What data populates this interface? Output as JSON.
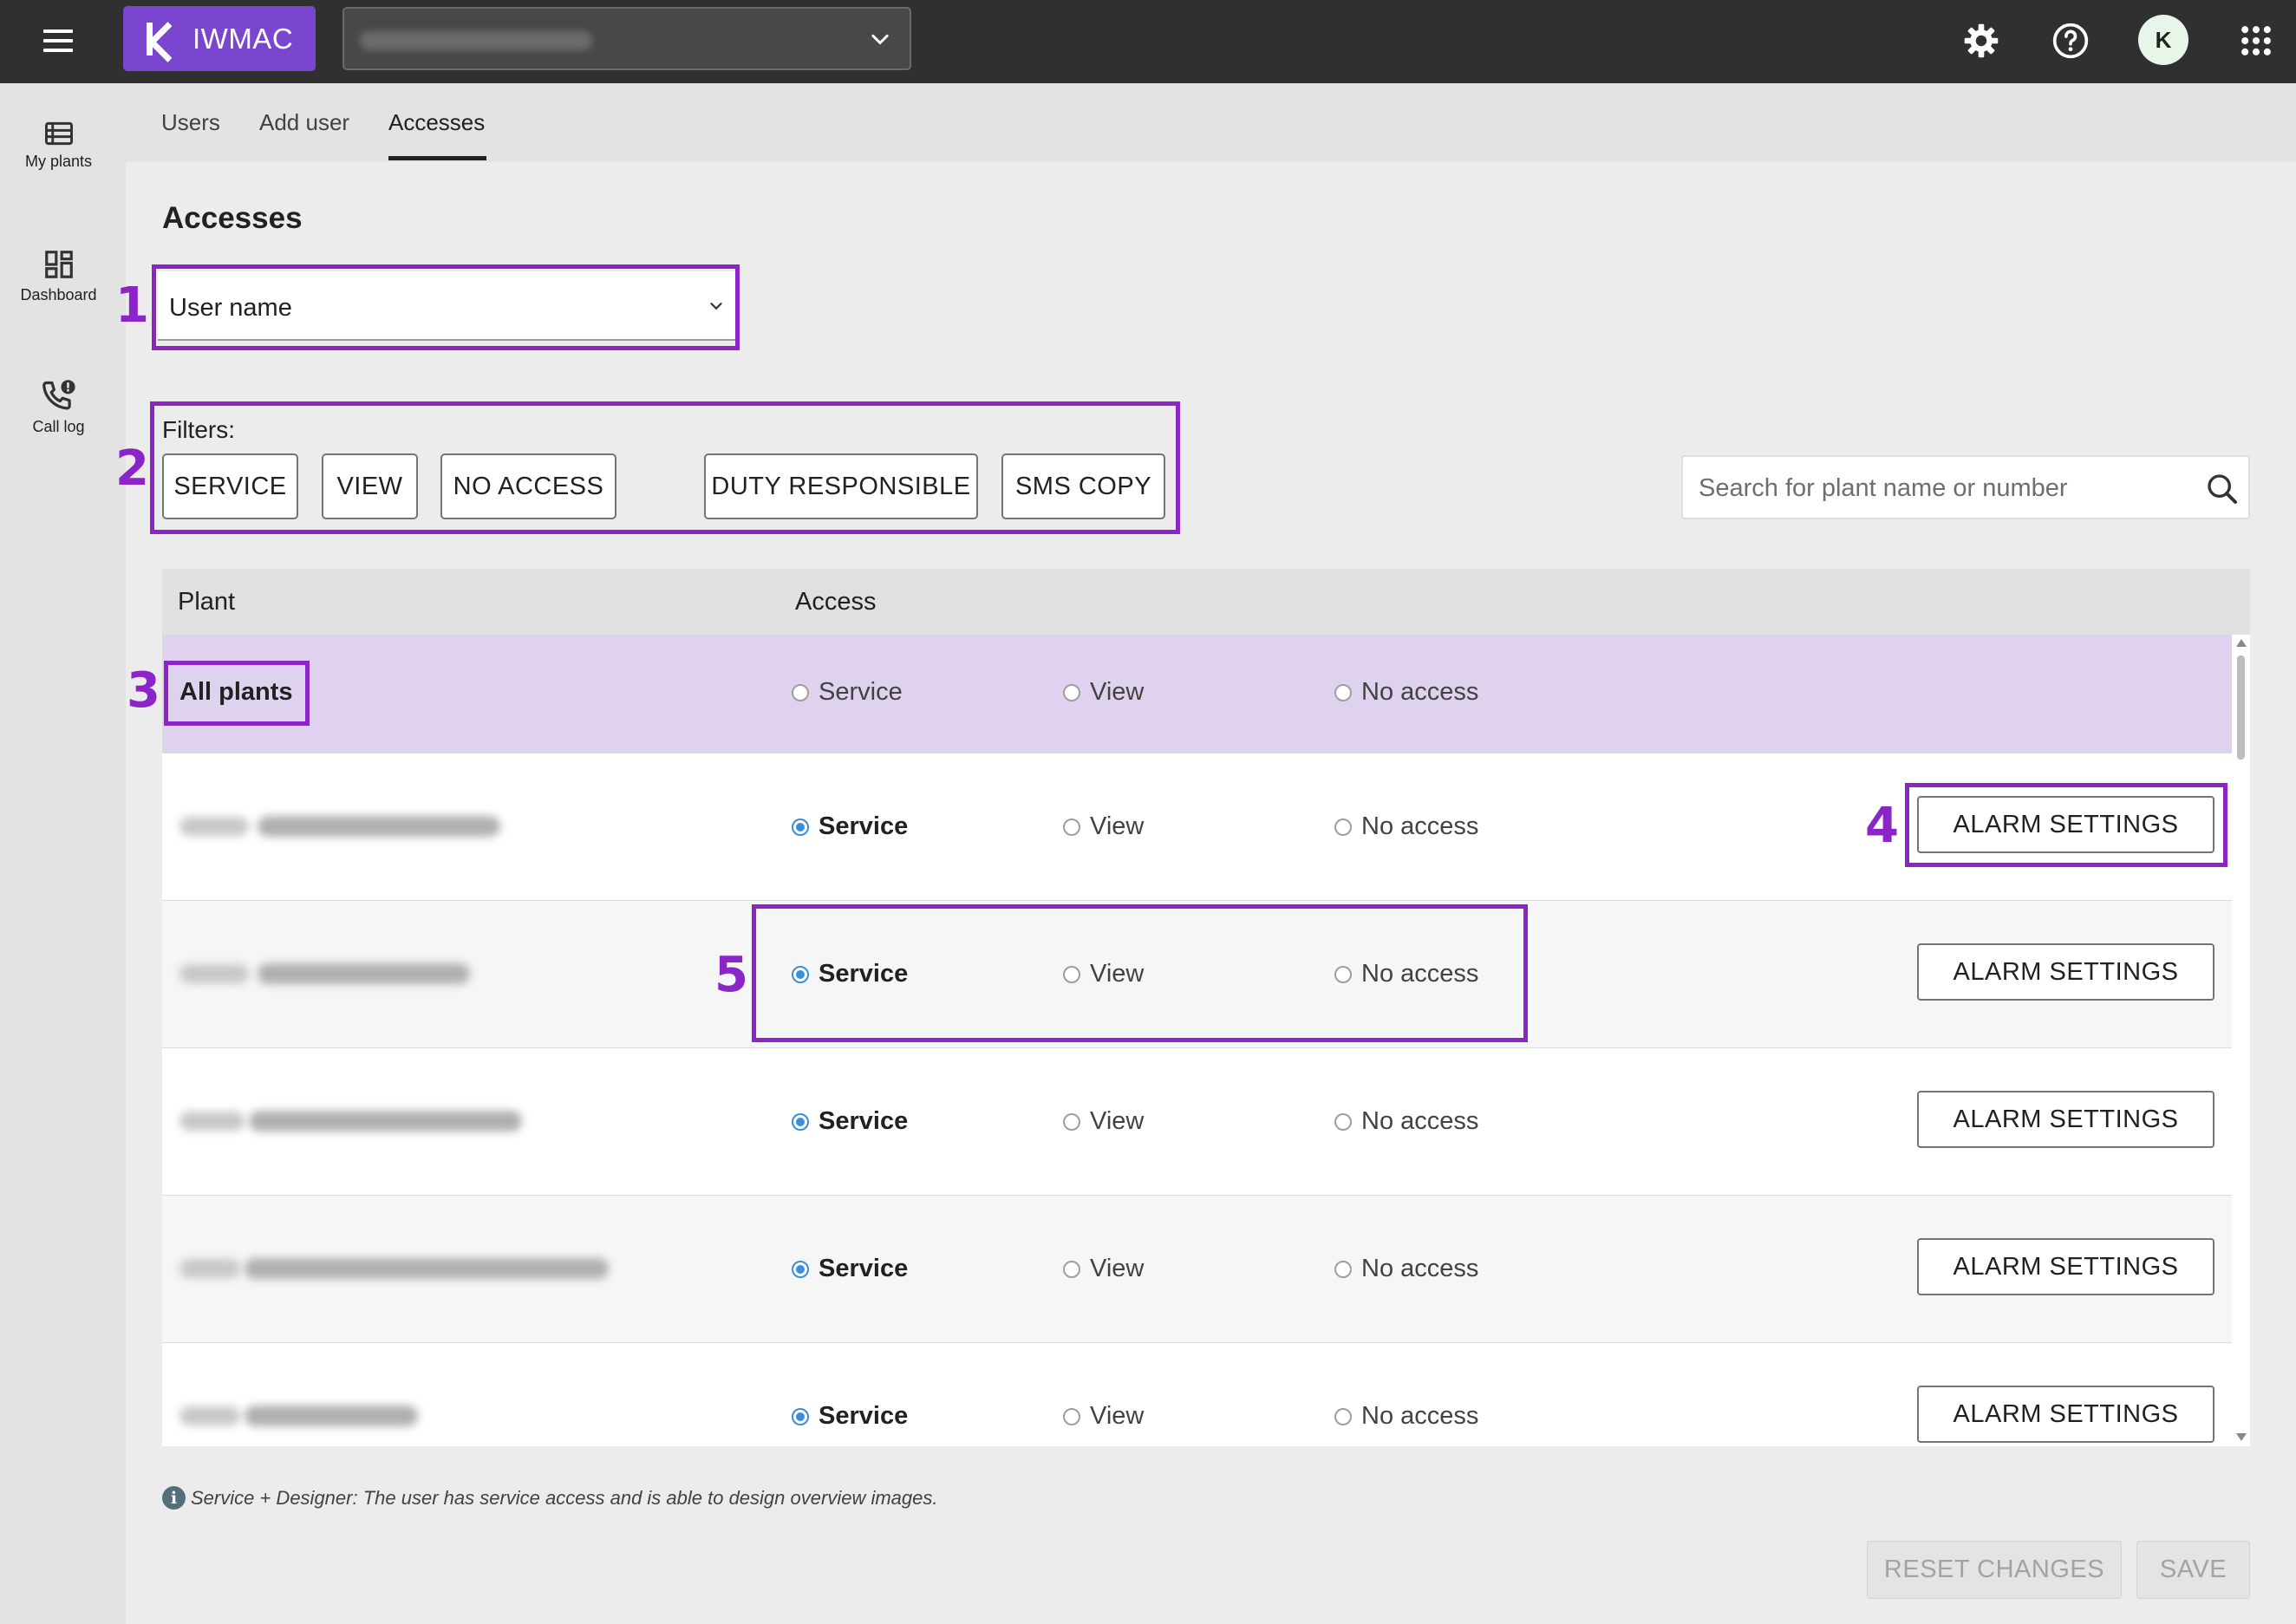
{
  "app": {
    "brand": "IWMAC",
    "user_initial": "K"
  },
  "icons": {
    "menu": "hamburger-menu-icon",
    "org_dropdown": "chevron-down-icon",
    "settings": "gear-icon",
    "help": "help-circle-icon",
    "apps": "apps-grid-icon",
    "search": "search-icon",
    "info": "info-icon"
  },
  "sidenav": {
    "items": [
      {
        "label": "My plants",
        "icon": "list-icon"
      },
      {
        "label": "Dashboard",
        "icon": "dashboard-icon"
      },
      {
        "label": "Call log",
        "icon": "phone-alert-icon"
      }
    ]
  },
  "tabs": [
    {
      "label": "Users",
      "active": false
    },
    {
      "label": "Add user",
      "active": false
    },
    {
      "label": "Accesses",
      "active": true
    }
  ],
  "main": {
    "title": "Accesses",
    "user_select": {
      "value": "User name"
    },
    "filters": {
      "label": "Filters:",
      "buttons": [
        "SERVICE",
        "VIEW",
        "NO ACCESS",
        "DUTY RESPONSIBLE",
        "SMS COPY"
      ]
    },
    "search": {
      "placeholder": "Search for plant name or number"
    },
    "table": {
      "columns": [
        "Plant",
        "Access"
      ],
      "options": [
        "Service",
        "View",
        "No access"
      ],
      "all_plants": {
        "label": "All plants",
        "selected": null
      },
      "rows": [
        {
          "selected": "Service",
          "action": "ALARM SETTINGS"
        },
        {
          "selected": "Service",
          "action": "ALARM SETTINGS"
        },
        {
          "selected": "Service",
          "action": "ALARM SETTINGS"
        },
        {
          "selected": "Service",
          "action": "ALARM SETTINGS"
        },
        {
          "selected": "Service",
          "action": "ALARM SETTINGS"
        }
      ]
    },
    "note": "Service + Designer: The user has service access  and is able to design overview images.",
    "actions": {
      "reset": "RESET CHANGES",
      "save": "SAVE"
    }
  },
  "annotations": [
    "1",
    "2",
    "3",
    "4",
    "5"
  ],
  "colors": {
    "topbar": "#303030",
    "brand": "#7b46cf",
    "annotation": "#8b25c8",
    "all_plants_row": "#ded2ee",
    "radio_selected": "#3a8fd8"
  }
}
